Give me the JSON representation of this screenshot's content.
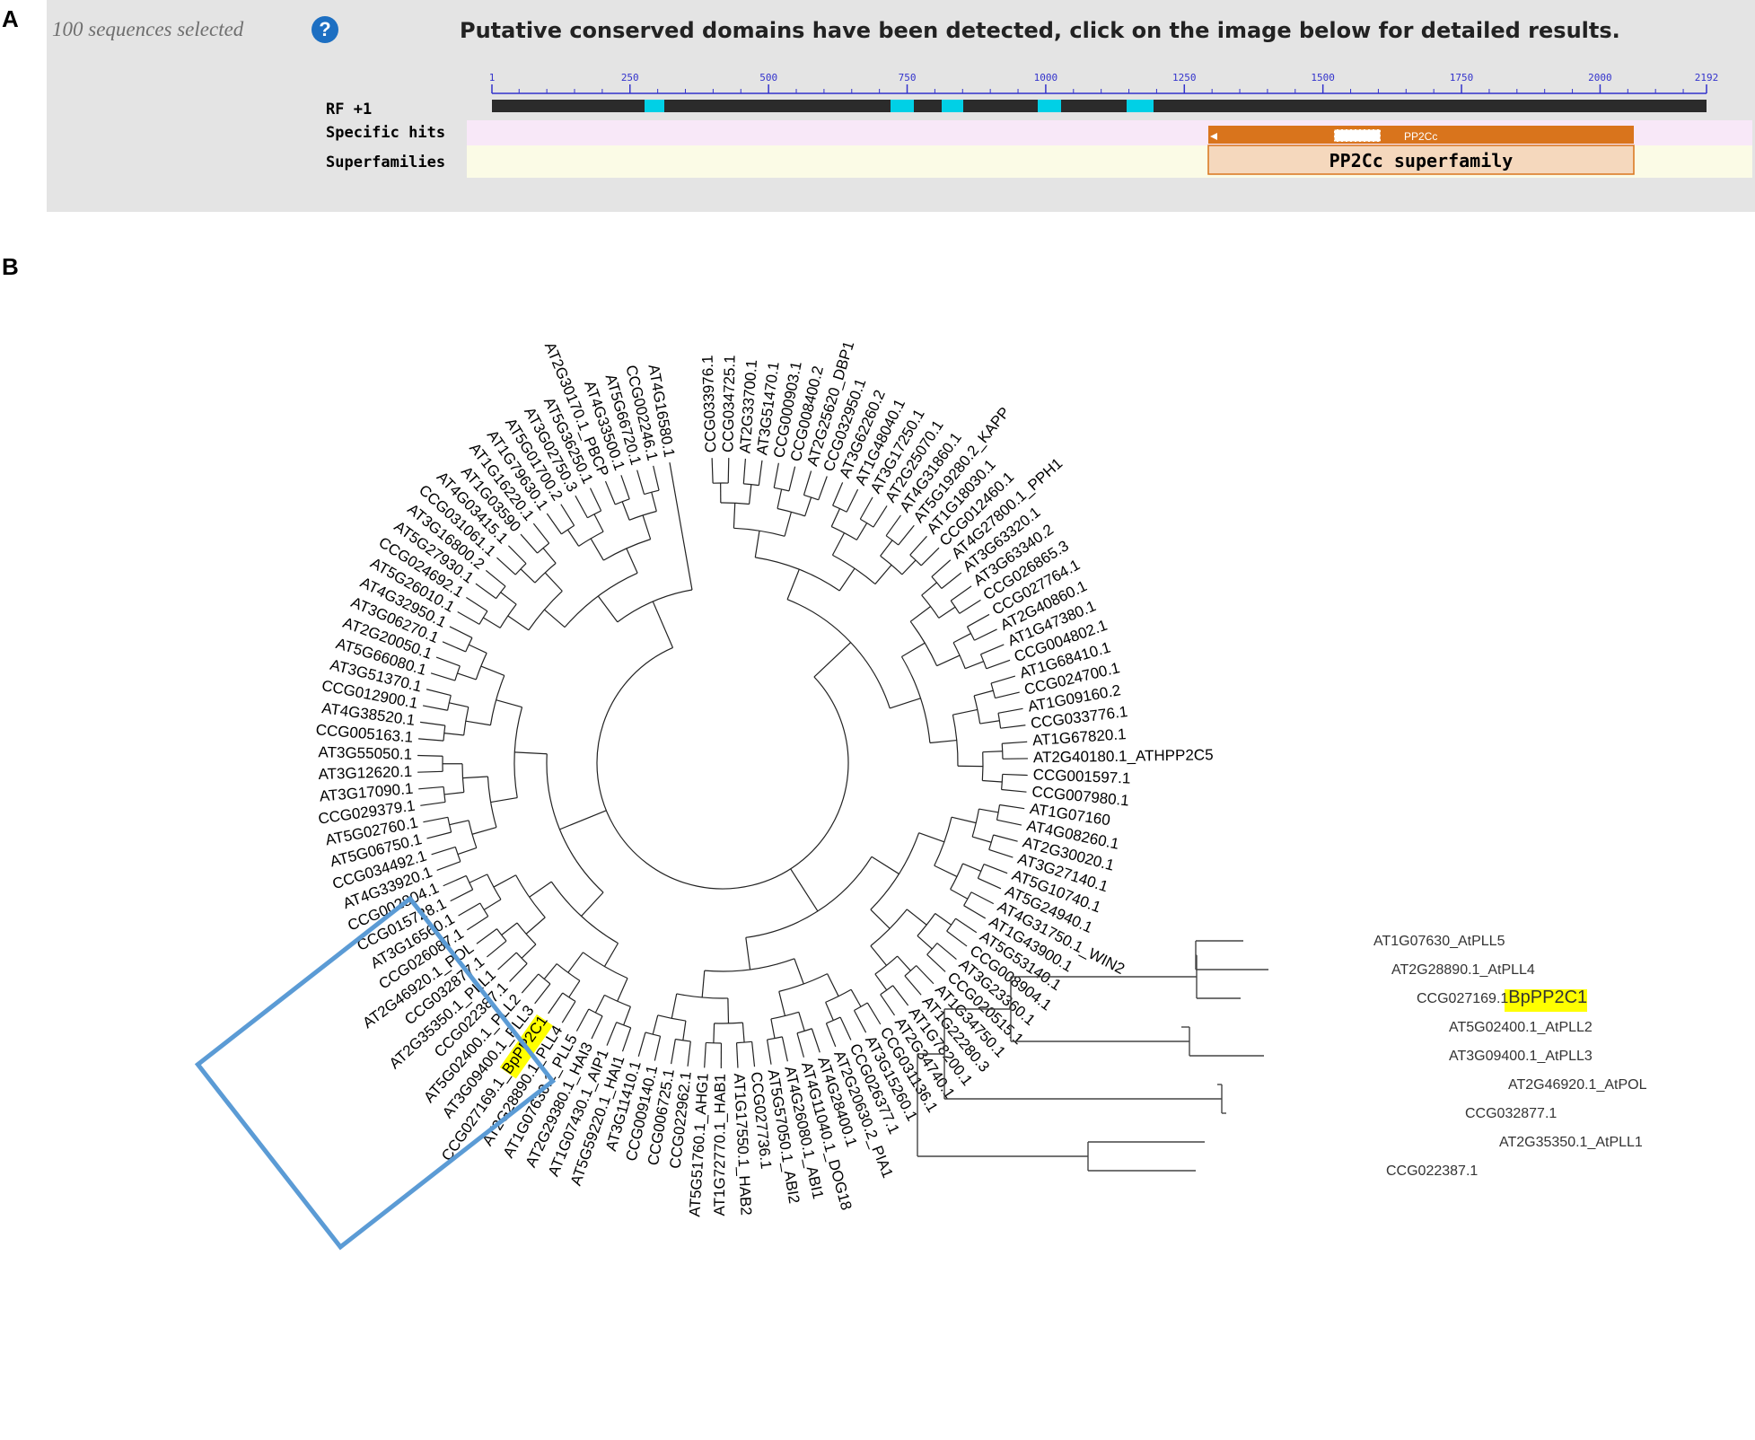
{
  "panels": {
    "a": "A",
    "b": "B"
  },
  "cdd": {
    "sequences_selected": "100 sequences selected",
    "help_icon": "question-circle-icon",
    "message": "Putative conserved domains have been detected, click on the image below for detailed results.",
    "ruler_ticks": [
      "1",
      "250",
      "500",
      "750",
      "1000",
      "1250",
      "1500",
      "1750",
      "2000",
      "2192"
    ],
    "track_labels": {
      "frame": "RF +1",
      "specific": "Specific hits",
      "superfamilies": "Superfamilies"
    },
    "specific_hit_label": "PP2Cc",
    "superfamily_label": "PP2Cc superfamily",
    "colors": {
      "panel_bg": "#e4e4e4",
      "sequence_bar": "#2b2b2b",
      "highlight": "#00d0e6",
      "specific_row": "#f8e8f8",
      "super_row": "#fbfbe6",
      "hit": "#d9741c",
      "super_box": "#f5d8bd"
    }
  },
  "circular_tree": {
    "leaves_cw": [
      "CCG033976.1",
      "CCG034725.1",
      "AT2G33700.1",
      "AT3G51470.1",
      "CCG000903.1",
      "CCG008400.2",
      "AT2G25620_DBP1",
      "CCG032950.1",
      "AT3G62260.2",
      "AT1G48040.1",
      "AT3G17250.1",
      "AT2G25070.1",
      "AT4G31860.1",
      "AT5G19280.2_KAPP",
      "AT1G18030.1",
      "CCG012460.1",
      "AT4G27800.1_PPH1",
      "AT3G63320.1",
      "AT3G63340.2",
      "CCG026865.3",
      "CCG027764.1",
      "AT2G40860.1",
      "AT1G47380.1",
      "CCG004802.1",
      "AT1G68410.1",
      "CCG024700.1",
      "AT1G09160.2",
      "CCG033776.1",
      "AT1G67820.1",
      "AT2G40180.1_ATHPP2C5",
      "CCG001597.1",
      "CCG007980.1",
      "AT1G07160",
      "AT4G08260.1",
      "AT2G30020.1",
      "AT3G27140.1",
      "AT5G10740.1",
      "AT5G24940.1",
      "AT4G31750.1_WIN2",
      "AT1G43900.1",
      "AT5G53140.1",
      "CCG008904.1",
      "AT3G23360.1",
      "CCG020515.1",
      "AT1G34750.1",
      "AT1G22280.3",
      "AT1G78200.1",
      "AT2G34740.1",
      "CCG031136.1",
      "AT3G15260.1",
      "CCG026377.1",
      "AT2G20630.2_PIA1",
      "AT4G28400.1",
      "AT4G11040.1_DOG18",
      "AT4G26080.1_ABI1",
      "AT5G57050.1_ABI2",
      "CCG027736.1",
      "AT1G17550.1_HAB2",
      "AT1G72770.1_HAB1",
      "AT5G51760.1_AHG1",
      "CCG022962.1",
      "CCG006725.1",
      "CCG009140.1",
      "AT3G11410.1",
      "AT5G59220.1_HAI1",
      "AT1G07430.1_AIP1",
      "AT2G29380.1_HAI3",
      "AT1G07630.1_PLL5",
      "AT2G28890.1_PLL4",
      "CCG027169.1_BpPP2C1",
      "AT3G09400.1_PLL3",
      "AT5G02400.1_PLL2",
      "CCG022387.1",
      "AT2G35350.1_PLL1",
      "CCG032877.1",
      "AT2G46920.1_POL",
      "CCG026087.1",
      "AT3G16560.1",
      "CCG015728.1",
      "CCG002804.1",
      "AT4G33920.1",
      "CCG034492.1",
      "AT5G06750.1",
      "AT5G02760.1",
      "CCG029379.1",
      "AT3G17090.1",
      "AT3G12620.1",
      "AT3G55050.1",
      "CCG005163.1",
      "AT4G38520.1",
      "CCG012900.1",
      "AT3G51370.1",
      "AT5G66080.1",
      "AT2G20050.1",
      "AT3G06270.1",
      "AT4G32950.1",
      "AT5G26010.1",
      "CCG024692.1",
      "AT5G27930.1",
      "AT3G16800.2",
      "CCG031061.1",
      "AT4G03415.1",
      "AT1G03590",
      "AT1G16220.1",
      "AT1G79630.1",
      "AT5G01700.2",
      "AT3G02750.3",
      "AT5G36250.1",
      "AT2G30170.1_PBCP",
      "AT4G33500.1",
      "AT5G66720.1",
      "CCG002246.1",
      "AT4G16580.1"
    ],
    "highlighted_leaf": "CCG027169.1_BpPP2C1",
    "highlight_color": "#ffff00",
    "box_color": "#5b9bd5"
  },
  "sub_tree": {
    "leaves": [
      {
        "id": "AT1G07630_AtPLL5",
        "text": "AT1G07630_AtPLL5",
        "hl": ""
      },
      {
        "id": "AT2G28890.1_AtPLL4",
        "text": "AT2G28890.1_AtPLL4",
        "hl": ""
      },
      {
        "id": "CCG027169.1",
        "text": "CCG027169.1",
        "hl": "BpPP2C1"
      },
      {
        "id": "AT5G02400.1_AtPLL2",
        "text": "AT5G02400.1_AtPLL2",
        "hl": ""
      },
      {
        "id": "AT3G09400.1_AtPLL3",
        "text": "AT3G09400.1_AtPLL3",
        "hl": ""
      },
      {
        "id": "AT2G46920.1_AtPOL",
        "text": "AT2G46920.1_AtPOL",
        "hl": ""
      },
      {
        "id": "CCG032877.1",
        "text": "CCG032877.1",
        "hl": ""
      },
      {
        "id": "AT2G35350.1_AtPLL1",
        "text": "AT2G35350.1_AtPLL1",
        "hl": ""
      },
      {
        "id": "CCG022387.1",
        "text": "CCG022387.1",
        "hl": ""
      }
    ]
  }
}
